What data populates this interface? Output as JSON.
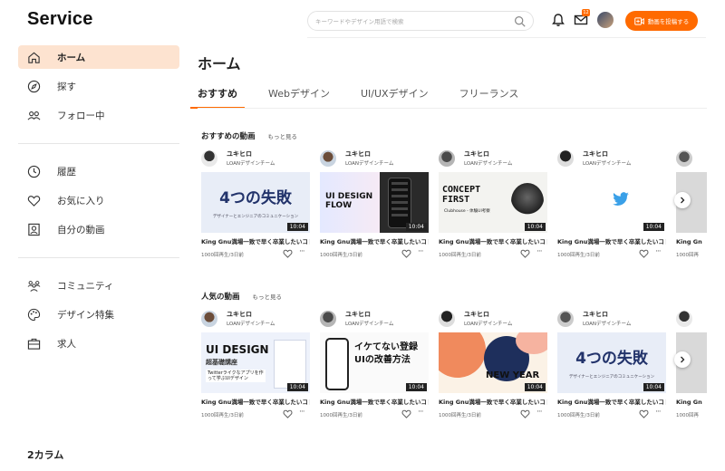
{
  "header": {
    "logo": "Service",
    "search_placeholder": "キーワードやデザイン用語で検索",
    "mail_badge": "12",
    "post_button": "動画を投稿する"
  },
  "sidebar": {
    "groups": [
      [
        {
          "label": "ホーム",
          "icon": "home-icon",
          "active": true
        },
        {
          "label": "探す",
          "icon": "compass-icon"
        },
        {
          "label": "フォロー中",
          "icon": "users-icon"
        }
      ],
      [
        {
          "label": "履歴",
          "icon": "clock-icon"
        },
        {
          "label": "お気に入り",
          "icon": "heart-icon"
        },
        {
          "label": "自分の動画",
          "icon": "profile-icon"
        }
      ],
      [
        {
          "label": "コミュニティ",
          "icon": "community-icon"
        },
        {
          "label": "デザイン特集",
          "icon": "palette-icon"
        },
        {
          "label": "求人",
          "icon": "briefcase-icon"
        }
      ]
    ]
  },
  "footer_label": "2カラム",
  "main": {
    "title": "ホーム",
    "tabs": [
      {
        "label": "おすすめ",
        "active": true
      },
      {
        "label": "Webデザイン"
      },
      {
        "label": "UI/UXデザイン"
      },
      {
        "label": "フリーランス"
      }
    ],
    "sections": [
      {
        "title": "おすすめの動画",
        "more": "もっと見る",
        "cards": [
          {
            "author": "ユキヒロ",
            "team": "LOANデザインチーム",
            "duration": "10:04",
            "title": "King Gnu満場一致で早く卒業したいコトとは…？！（最後まで動画を見て下さい）",
            "meta": "1000回再生/3日前",
            "thumb": "four-failures",
            "thumb_text": "4つの失敗",
            "thumb_sub": "デザイナーとエンジニアのコミュニケーション"
          },
          {
            "author": "ユキヒロ",
            "team": "LOANデザインチーム",
            "duration": "10:04",
            "title": "King Gnu満場一致で早く卒業したいコトとは…？！（最後まで動画を見て下さい）",
            "meta": "1000回再生/3日前",
            "thumb": "ui-design-flow",
            "thumb_text": "UI DESIGN FLOW"
          },
          {
            "author": "ユキヒロ",
            "team": "LOANデザインチーム",
            "duration": "10:04",
            "title": "King Gnu満場一致で早く卒業したいコトとは…？！（最後まで動画を見て下さい）",
            "meta": "1000回再生/3日前",
            "thumb": "concept-first",
            "thumb_text": "CONCEPT FIRST",
            "thumb_sub": "Clubhouse - 体験UI考察"
          },
          {
            "author": "ユキヒロ",
            "team": "LOANデザインチーム",
            "duration": "10:04",
            "title": "King Gnu満場一致で早く卒業したいコトとは…？！（最後まで動画を見て下さい）",
            "meta": "1000回再生/3日前",
            "thumb": "twitter-bird"
          },
          {
            "author": "",
            "team": "",
            "duration": "",
            "title": "King Gn",
            "meta": "1000回再",
            "thumb": "gray"
          }
        ]
      },
      {
        "title": "人気の動画",
        "more": "もっと見る",
        "cards": [
          {
            "author": "ユキヒロ",
            "team": "LOANデザインチーム",
            "duration": "10:04",
            "title": "King Gnu満場一致で早く卒業したいコトとは…？！（最後まで動画を見て下さい）",
            "meta": "1000回再生/3日前",
            "thumb": "ui-design-course",
            "thumb_text": "UI DESIGN",
            "thumb_sub": "超基礎講座",
            "thumb_sub2": "Twitterライクなアプリを作って学ぶUIデザイン"
          },
          {
            "author": "ユキヒロ",
            "team": "LOANデザインチーム",
            "duration": "10:04",
            "title": "King Gnu満場一致で早く卒業したいコトとは…？！（最後まで動画を見て下さい）",
            "meta": "1000回再生/3日前",
            "thumb": "ikete-nai",
            "thumb_text": "イケてない登録UIの改善方法"
          },
          {
            "author": "ユキヒロ",
            "team": "LOANデザインチーム",
            "duration": "10:04",
            "title": "King Gnu満場一致で早く卒業したいコトとは…？！（最後まで動画を見て下さい）",
            "meta": "1000回再生/3日前",
            "thumb": "new-year",
            "thumb_text": "NEW YEAR"
          },
          {
            "author": "ユキヒロ",
            "team": "LOANデザインチーム",
            "duration": "10:04",
            "title": "King Gnu満場一致で早く卒業したいコトとは…？！（最後まで動画を見て下さい）",
            "meta": "1000回再生/3日前",
            "thumb": "four-failures",
            "thumb_text": "4つの失敗",
            "thumb_sub": "デザイナーとエンジニアのコミュニケーション"
          },
          {
            "author": "",
            "team": "",
            "duration": "",
            "title": "King Gn",
            "meta": "1000回再",
            "thumb": "gray"
          }
        ]
      }
    ]
  },
  "colors": {
    "accent": "#ff6a00",
    "active_bg": "#fde3d0"
  }
}
